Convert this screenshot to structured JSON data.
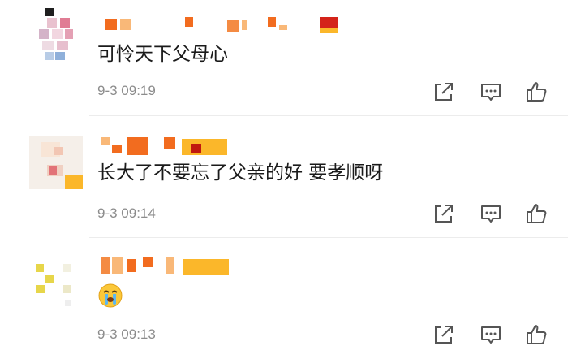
{
  "comments": [
    {
      "text": "可怜天下父母心",
      "time": "9-3 09:19"
    },
    {
      "text": "长大了不要忘了父亲的好 要孝顺呀",
      "time": "9-3 09:14"
    },
    {
      "emoji": "crying-face-icon",
      "time": "9-3 09:13"
    }
  ],
  "icons": {
    "share": "share-icon",
    "reply": "comment-icon",
    "like": "thumbs-up-icon"
  },
  "colors": {
    "text": "#1a1a1a",
    "time": "#8c8c8c",
    "icon": "#555555",
    "name_orange": "#f26c1f",
    "name_light": "#f9b878",
    "name_red": "#c0180f",
    "name_yellow": "#fbb72a"
  }
}
